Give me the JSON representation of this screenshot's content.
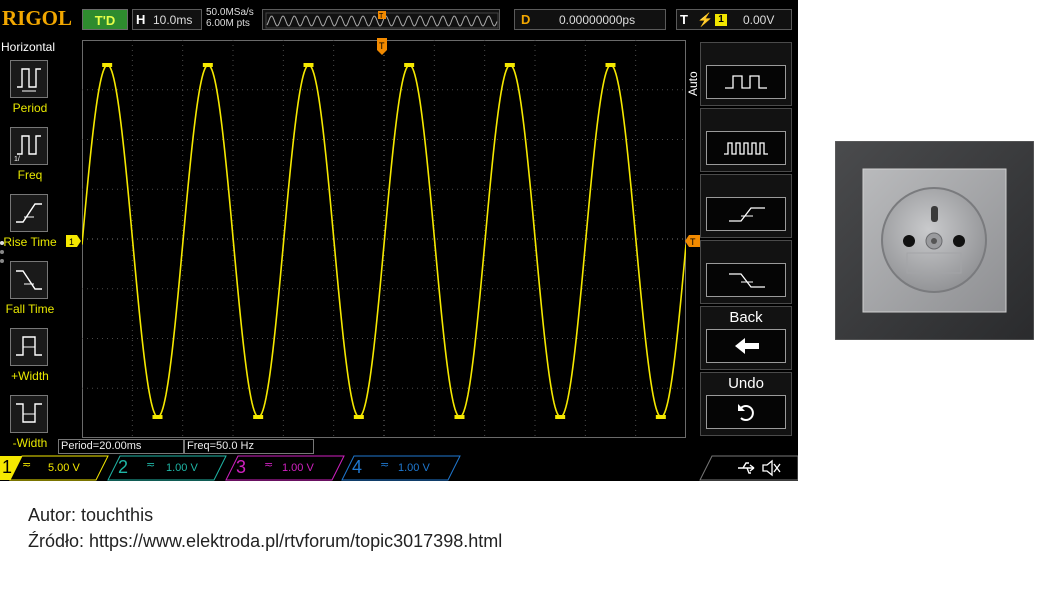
{
  "scope": {
    "brand": "RIGOL",
    "run_status": "T'D",
    "horizontal": {
      "label": "H",
      "value": "10.0ms"
    },
    "sample_rate": "50.0MSa/s",
    "mem_depth": "6.00M pts",
    "delay": {
      "label": "D",
      "value": "0.00000000ps"
    },
    "trigger": {
      "label": "T",
      "channel": "1",
      "level": "0.00V"
    },
    "left_menu": {
      "title": "Horizontal",
      "items": [
        {
          "label": "Period",
          "icon": "period-icon"
        },
        {
          "label": "Freq",
          "icon": "frequency-icon"
        },
        {
          "label": "Rise Time",
          "icon": "rise-time-icon"
        },
        {
          "label": "Fall Time",
          "icon": "fall-time-icon"
        },
        {
          "label": "+Width",
          "icon": "positive-width-icon"
        },
        {
          "label": "-Width",
          "icon": "negative-width-icon"
        }
      ]
    },
    "right_menu": {
      "title": "Auto",
      "items": [
        {
          "label": "",
          "icon": "single-pulse-icon"
        },
        {
          "label": "",
          "icon": "multi-pulse-icon"
        },
        {
          "label": "",
          "icon": "rising-edge-icon"
        },
        {
          "label": "",
          "icon": "falling-edge-icon"
        },
        {
          "label": "Back",
          "icon": "back-arrow-icon"
        },
        {
          "label": "Undo",
          "icon": "undo-icon"
        }
      ]
    },
    "measurements": {
      "period": "Period=20.00ms",
      "freq": "Freq=50.0 Hz"
    },
    "channels": [
      {
        "num": "1",
        "scale": "5.00 V",
        "color": "#f5e800"
      },
      {
        "num": "2",
        "scale": "1.00 V",
        "color": "#1fb6a6"
      },
      {
        "num": "3",
        "scale": "1.00 V",
        "color": "#d020c0"
      },
      {
        "num": "4",
        "scale": "1.00 V",
        "color": "#1f78d0"
      }
    ],
    "trace_color": "#f5e800",
    "accent_color": "#f28a00",
    "status_icons": [
      "usb-icon",
      "speaker-icon"
    ],
    "markers": {
      "trigger_pos": "T",
      "channel_ref": "1",
      "trigger_level": "T"
    }
  },
  "caption": {
    "author": "Autor: touchthis",
    "source": "Źródło: https://www.elektroda.pl/rtvforum/topic3017398.html"
  }
}
